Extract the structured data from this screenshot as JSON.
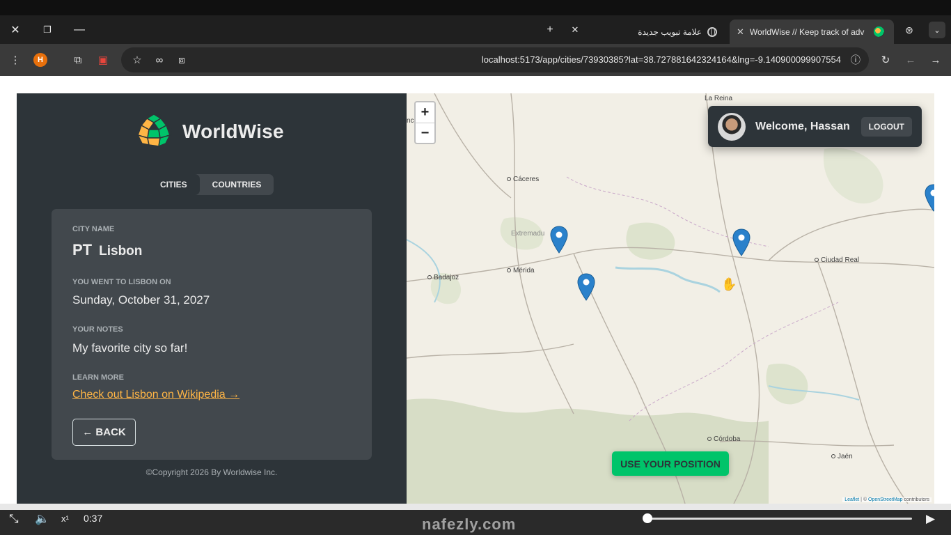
{
  "browser": {
    "tabs": [
      {
        "title": "علامة تبويب جديدة",
        "icon": "globe-icon",
        "active": false
      },
      {
        "title": "WorldWise // Keep track of adv",
        "icon": "worldwise-favicon",
        "active": true
      }
    ],
    "url": "localhost:5173/app/cities/73930385?lat=38.727881642324164&lng=-9.140900099907554",
    "profile_initial": "H"
  },
  "app": {
    "logo_text": "WorldWise",
    "tabs": [
      {
        "label": "CITIES",
        "active": true
      },
      {
        "label": "COUNTRIES",
        "active": false
      }
    ],
    "city": {
      "name_label": "CITY NAME",
      "flag": "PT",
      "name": "Lisbon",
      "date_label": "YOU WENT TO LISBON ON",
      "date": "Sunday, October 31, 2027",
      "notes_label": "YOUR NOTES",
      "notes": "My favorite city so far!",
      "learn_label": "LEARN MORE",
      "wiki_link": "Check out Lisbon on Wikipedia →",
      "back_button": "← BACK"
    },
    "copyright": "©Copyright 2026 By Worldwise Inc.",
    "user": {
      "welcome": "Welcome, Hassan",
      "logout": "LOGOUT"
    },
    "use_position": "USE YOUR POSITION",
    "colors": {
      "dark": "#2d3439",
      "medium": "#42484d",
      "brand_green": "#00c46a",
      "brand_orange": "#ffb545",
      "pin": "#2a81cb"
    }
  },
  "map": {
    "zoom_in": "+",
    "zoom_out": "−",
    "places": [
      {
        "name": "La Reina"
      },
      {
        "name": "Cáceres"
      },
      {
        "name": "Extremadu"
      },
      {
        "name": "Mérida"
      },
      {
        "name": "Badajoz"
      },
      {
        "name": "Ciudad Real"
      },
      {
        "name": "Córdoba"
      },
      {
        "name": "Jaén"
      },
      {
        "name": "nc"
      }
    ],
    "attribution_leaflet": "Leaflet",
    "attribution_osm": "OpenStreetMap",
    "attribution_rest": "contributors"
  },
  "player": {
    "time": "0:37",
    "watermark": "nafezly.com"
  }
}
